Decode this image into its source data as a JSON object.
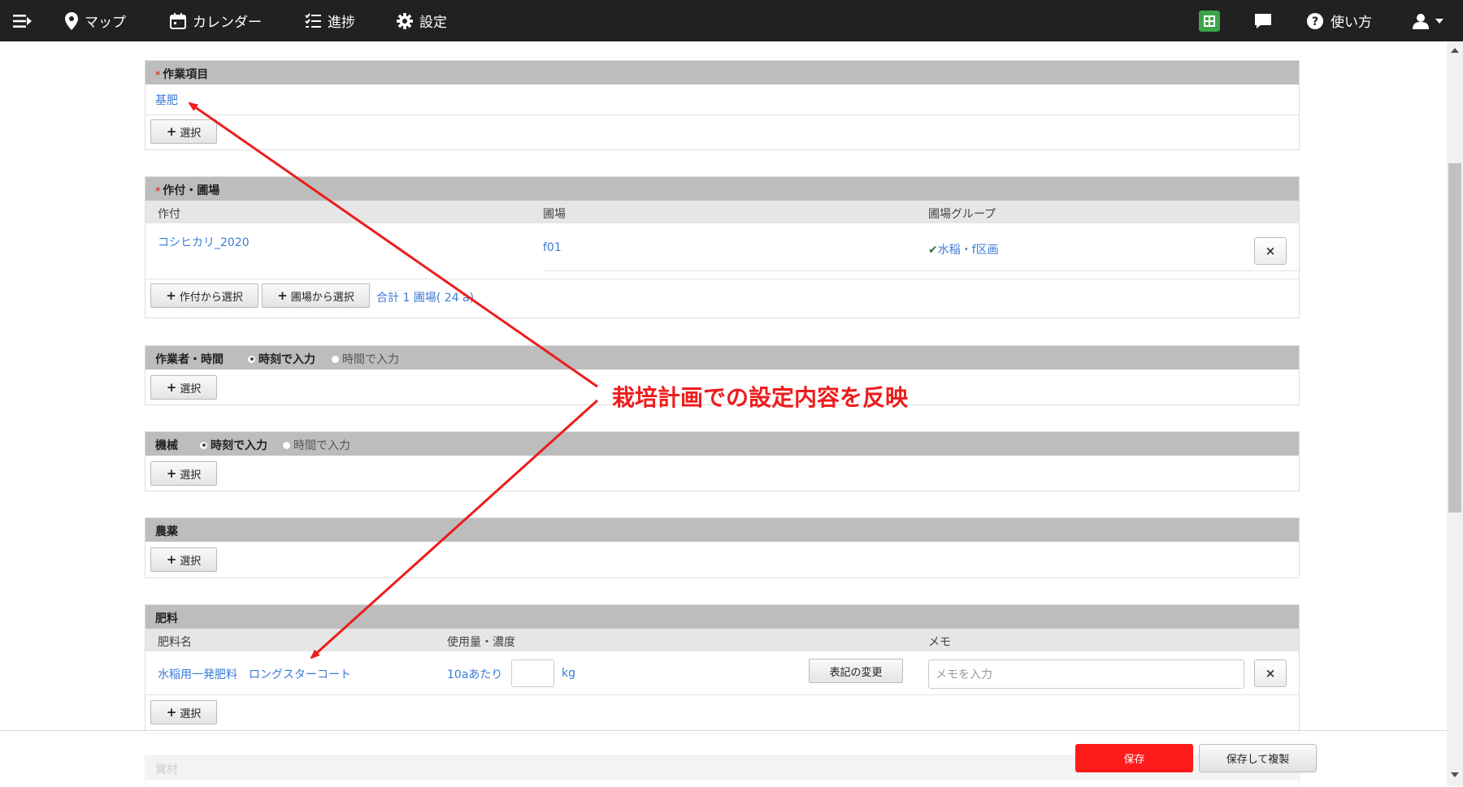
{
  "nav": {
    "map": "マップ",
    "calendar": "カレンダー",
    "progress": "進捗",
    "settings": "設定",
    "help": "使い方"
  },
  "work_item": {
    "title": "作業項目",
    "required": "*",
    "value": "基肥",
    "select": "選択"
  },
  "crop_field": {
    "title": "作付・圃場",
    "required": "*",
    "headers": [
      "作付",
      "圃場",
      "圃場グループ"
    ],
    "row": {
      "crop": "コシヒカリ_2020",
      "field": "f01",
      "group": "水稲・f区画"
    },
    "btn_from_crop": "作付から選択",
    "btn_from_field": "圃場から選択",
    "total": "合計 1 圃場( 24 a)"
  },
  "worker": {
    "title": "作業者・時間",
    "radio_time_of_day": "時刻で入力",
    "radio_duration": "時間で入力",
    "select": "選択"
  },
  "machine": {
    "title": "機械",
    "radio_time_of_day": "時刻で入力",
    "radio_duration": "時間で入力",
    "select": "選択"
  },
  "pesticide": {
    "title": "農薬",
    "select": "選択"
  },
  "fertilizer": {
    "title": "肥料",
    "headers": [
      "肥料名",
      "使用量・濃度",
      "メモ"
    ],
    "row": {
      "name": "水稲用一発肥料　ロングスターコート",
      "per": "10aあたり",
      "amount": "",
      "unit": "kg",
      "change_notation": "表記の変更",
      "memo_placeholder": "メモを入力"
    },
    "select": "選択"
  },
  "materials": {
    "title": "資材"
  },
  "footer": {
    "save": "保存",
    "save_copy": "保存して複製"
  },
  "annotation": "栽培計画での設定内容を反映",
  "colors": {
    "navbar": "#212121",
    "section_header": "#bdbdbd",
    "link": "#3a7bd5",
    "save": "#ff1a1a",
    "annotation": "#ee1c1c"
  },
  "icons": {
    "menu": "menu-icon",
    "map": "map-pin-icon",
    "calendar": "calendar-icon",
    "progress": "checklist-icon",
    "settings": "gear-icon",
    "sheet": "spreadsheet-icon",
    "chat": "chat-icon",
    "help": "help-circle-icon",
    "user": "user-icon",
    "remove": "close-icon",
    "group": "rice-plant-icon"
  }
}
